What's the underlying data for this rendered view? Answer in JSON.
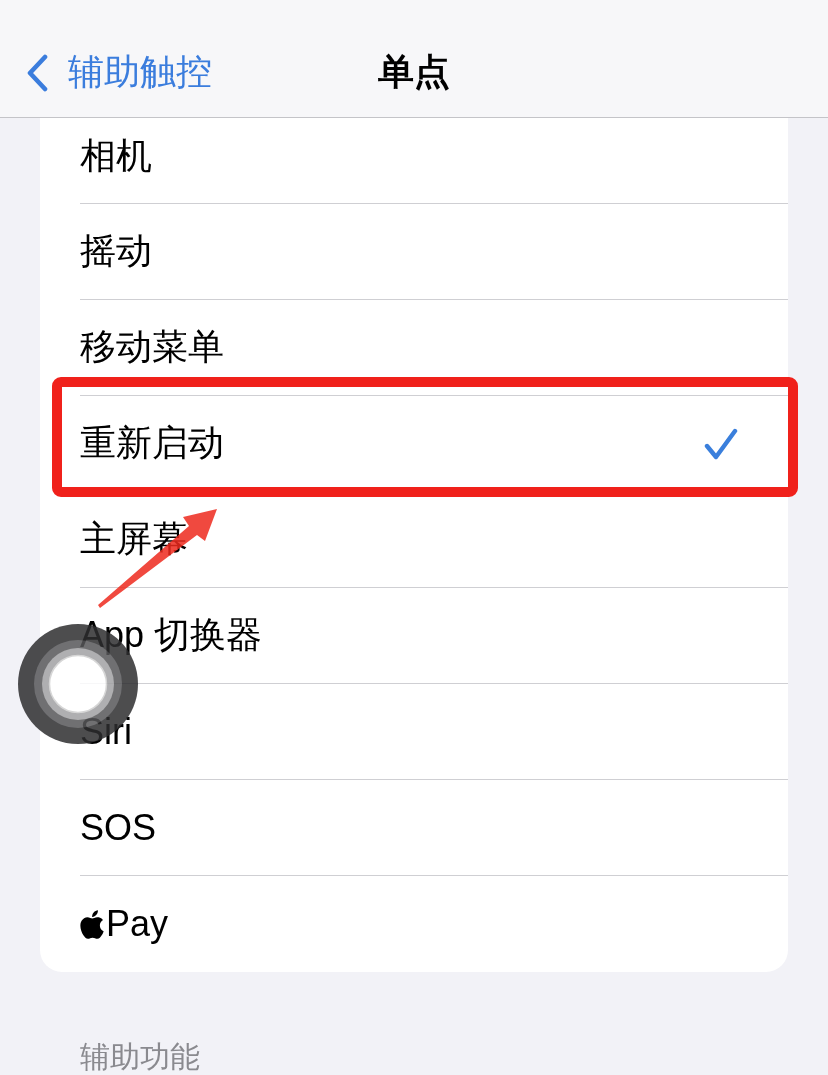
{
  "nav_bar": {
    "back_label": "辅助触控",
    "title": "单点"
  },
  "items": [
    {
      "label": "相机",
      "kind": "plain",
      "selected": false,
      "highlighted": false
    },
    {
      "label": "摇动",
      "kind": "plain",
      "selected": false,
      "highlighted": false
    },
    {
      "label": "移动菜单",
      "kind": "plain",
      "selected": false,
      "highlighted": false
    },
    {
      "label": "重新启动",
      "kind": "plain",
      "selected": true,
      "highlighted": true
    },
    {
      "label": "主屏幕",
      "kind": "plain",
      "selected": false,
      "highlighted": false
    },
    {
      "label": "App 切换器",
      "kind": "plain",
      "selected": false,
      "highlighted": false
    },
    {
      "label": "Siri",
      "kind": "plain",
      "selected": false,
      "highlighted": false
    },
    {
      "label": "SOS",
      "kind": "plain",
      "selected": false,
      "highlighted": false
    },
    {
      "label": "Pay",
      "kind": "logo",
      "selected": false,
      "highlighted": false
    }
  ],
  "section_header": "辅助功能"
}
